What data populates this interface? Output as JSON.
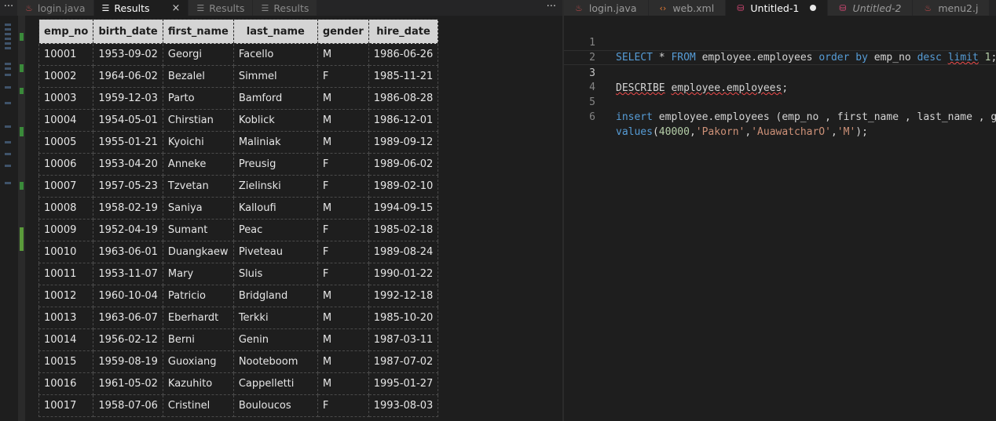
{
  "left_tabs": [
    {
      "label": "login.java",
      "icon": "java-icon",
      "active": false
    },
    {
      "label": "Results",
      "icon": "results-icon",
      "active": true,
      "close": "×"
    },
    {
      "label": "Results",
      "icon": "results-icon",
      "active": false
    },
    {
      "label": "Results",
      "icon": "results-icon",
      "active": false
    }
  ],
  "more_label": "···",
  "results": {
    "columns": [
      "emp_no",
      "birth_date",
      "first_name",
      "last_name",
      "gender",
      "hire_date"
    ],
    "rows": [
      [
        "10001",
        "1953-09-02",
        "Georgi",
        "Facello",
        "M",
        "1986-06-26"
      ],
      [
        "10002",
        "1964-06-02",
        "Bezalel",
        "Simmel",
        "F",
        "1985-11-21"
      ],
      [
        "10003",
        "1959-12-03",
        "Parto",
        "Bamford",
        "M",
        "1986-08-28"
      ],
      [
        "10004",
        "1954-05-01",
        "Chirstian",
        "Koblick",
        "M",
        "1986-12-01"
      ],
      [
        "10005",
        "1955-01-21",
        "Kyoichi",
        "Maliniak",
        "M",
        "1989-09-12"
      ],
      [
        "10006",
        "1953-04-20",
        "Anneke",
        "Preusig",
        "F",
        "1989-06-02"
      ],
      [
        "10007",
        "1957-05-23",
        "Tzvetan",
        "Zielinski",
        "F",
        "1989-02-10"
      ],
      [
        "10008",
        "1958-02-19",
        "Saniya",
        "Kalloufi",
        "M",
        "1994-09-15"
      ],
      [
        "10009",
        "1952-04-19",
        "Sumant",
        "Peac",
        "F",
        "1985-02-18"
      ],
      [
        "10010",
        "1963-06-01",
        "Duangkaew",
        "Piveteau",
        "F",
        "1989-08-24"
      ],
      [
        "10011",
        "1953-11-07",
        "Mary",
        "Sluis",
        "F",
        "1990-01-22"
      ],
      [
        "10012",
        "1960-10-04",
        "Patricio",
        "Bridgland",
        "M",
        "1992-12-18"
      ],
      [
        "10013",
        "1963-06-07",
        "Eberhardt",
        "Terkki",
        "M",
        "1985-10-20"
      ],
      [
        "10014",
        "1956-02-12",
        "Berni",
        "Genin",
        "M",
        "1987-03-11"
      ],
      [
        "10015",
        "1959-08-19",
        "Guoxiang",
        "Nooteboom",
        "M",
        "1987-07-02"
      ],
      [
        "10016",
        "1961-05-02",
        "Kazuhito",
        "Cappelletti",
        "M",
        "1995-01-27"
      ],
      [
        "10017",
        "1958-07-06",
        "Cristinel",
        "Bouloucos",
        "F",
        "1993-08-03"
      ]
    ]
  },
  "right_tabs": [
    {
      "label": "login.java",
      "icon": "java-icon"
    },
    {
      "label": "web.xml",
      "icon": "xml-icon"
    },
    {
      "label": "Untitled-1",
      "icon": "database-icon",
      "active": true,
      "dirty": true
    },
    {
      "label": "Untitled-2",
      "icon": "database-icon",
      "italic": true
    },
    {
      "label": "menu2.j",
      "icon": "java-icon"
    }
  ],
  "editor": {
    "line_numbers": [
      "1",
      "2",
      "3",
      "4",
      "5",
      "6"
    ],
    "current_line": "3",
    "lines": [
      "SELECT * FROM employee.employees order by emp_no desc limit 1;",
      "",
      "DESCRIBE employee.employees;",
      "",
      "insert employee.employees (emp_no , first_name , last_name , ge",
      "values(40000,'Pakorn','AuawatcharO','M');"
    ]
  },
  "colors": {
    "background": "#1e1e1e",
    "keyword": "#569cd6",
    "string": "#ce9178",
    "number": "#b5cea8",
    "header_bg": "#d4d4d4"
  }
}
